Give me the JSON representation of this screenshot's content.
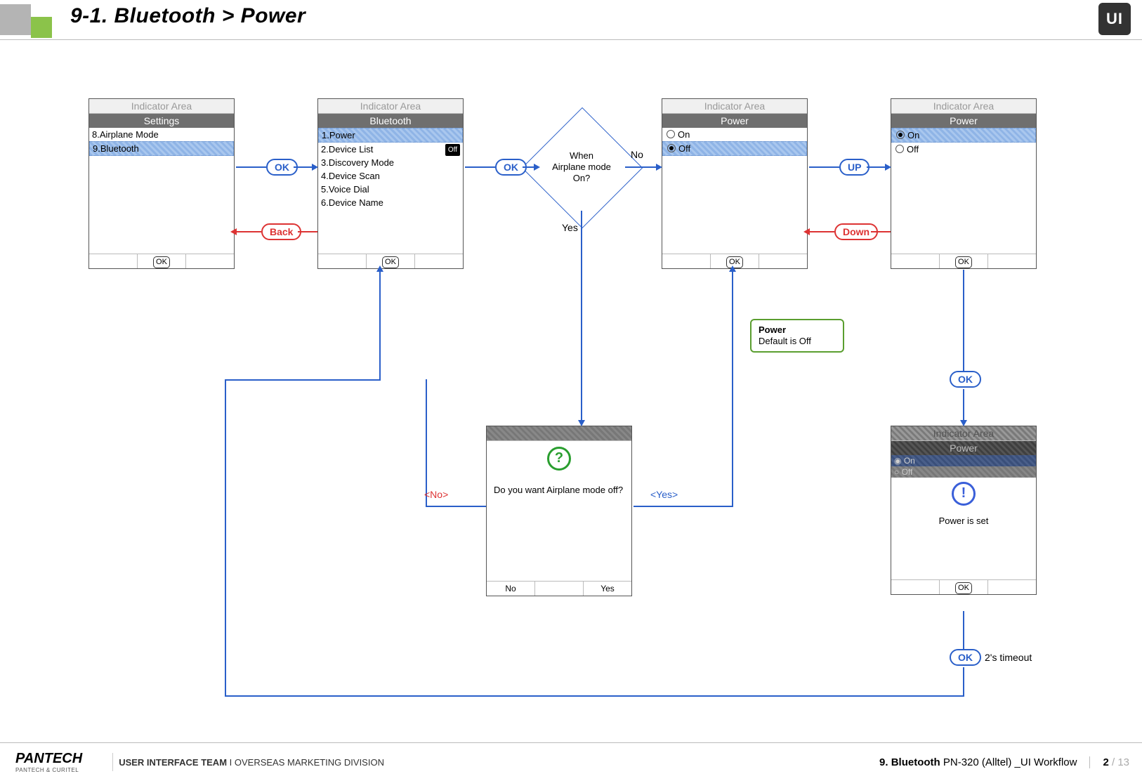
{
  "header": {
    "title": "9-1. Bluetooth > Power",
    "badge": "UI"
  },
  "pill": {
    "ok": "OK",
    "back": "Back",
    "up": "UP",
    "down": "Down"
  },
  "decision": {
    "text": "When\nAirplane mode\nOn?",
    "no": "No",
    "yes": "Yes"
  },
  "answers": {
    "no": "<No>",
    "yes": "<Yes>"
  },
  "note": {
    "title": "Power",
    "body": "Default is Off"
  },
  "timeout": "2's timeout",
  "common": {
    "indicator": "Indicator Area",
    "ok_soft": "OK"
  },
  "screens": {
    "settings": {
      "title": "Settings",
      "items": [
        "8.Airplane Mode",
        "9.Bluetooth"
      ]
    },
    "bluetooth": {
      "title": "Bluetooth",
      "items": [
        "1.Power",
        "2.Device List",
        "3.Discovery Mode",
        "4.Device Scan",
        "5.Voice Dial",
        "6.Device Name"
      ],
      "off": "Off"
    },
    "power1": {
      "title": "Power",
      "on": "On",
      "off": "Off"
    },
    "power2": {
      "title": "Power",
      "on": "On",
      "off": "Off"
    },
    "dialog": {
      "msg": "Do you want Airplane mode off?",
      "no": "No",
      "yes": "Yes"
    },
    "confirm": {
      "title": "Power",
      "on": "On",
      "off": "Off",
      "msg": "Power is set"
    }
  },
  "footer": {
    "logo_main": "PANTECH",
    "logo_sub": "PANTECH & CURITEL",
    "team_bold": "USER INTERFACE TEAM",
    "team_rest": " I  OVERSEAS MARKETING DIVISION",
    "section_bold": "9. Bluetooth",
    "section_rest": " PN-320 (Alltel) _UI Workflow",
    "page_cur": "2",
    "page_total": " / 13"
  }
}
